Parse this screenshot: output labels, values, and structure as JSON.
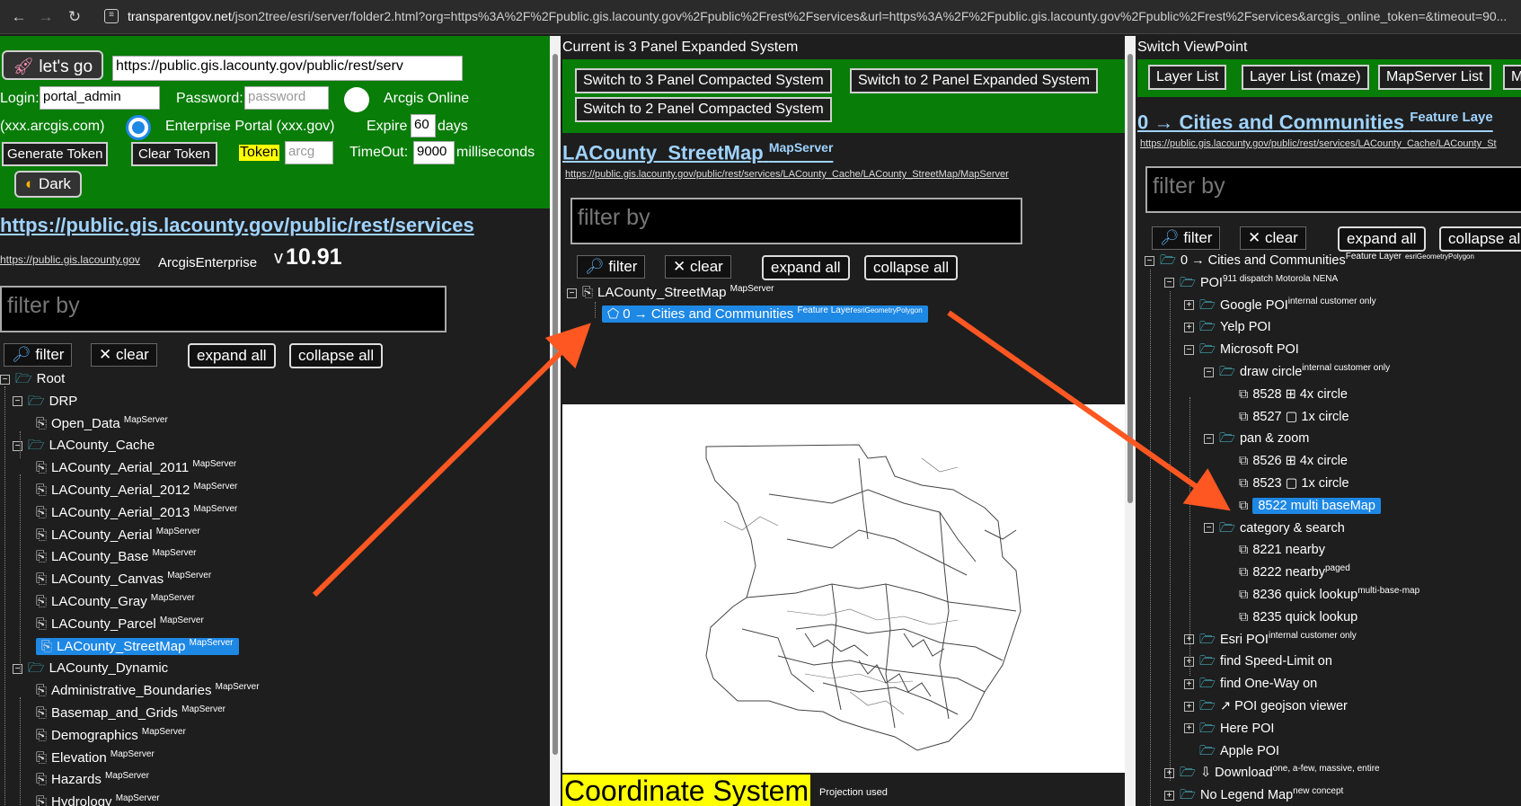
{
  "browser": {
    "url_host": "transparentgov.net",
    "url_rest": "/json2tree/esri/server/folder2.html?org=https%3A%2F%2Fpublic.gis.lacounty.gov%2Fpublic%2Frest%2Fservices&url=https%3A%2F%2Fpublic.gis.lacounty.gov%2Fpublic%2Frest%2Fservices&arcgis_online_token=&timeout=90..."
  },
  "left": {
    "lets_go": "let's go",
    "url_value": "https://public.gis.lacounty.gov/public/rest/serv",
    "login_label": "Login:",
    "login_value": "portal_admin",
    "password_label": "Password:",
    "password_placeholder": "password",
    "arcgis_online": "Arcgis Online",
    "arcgis_com": "(xxx.arcgis.com)",
    "enterprise": "Enterprise Portal (xxx.gov)",
    "expire_label": "Expire",
    "expire_value": "60",
    "days": "days",
    "generate_token": "Generate Token",
    "clear_token": "Clear Token",
    "token_label": "Token",
    "token_placeholder": "arcg",
    "timeout_label": "TimeOut:",
    "timeout_value": "9000",
    "milliseconds": "milliseconds",
    "dark": "Dark",
    "services_link": "https://public.gis.lacounty.gov/public/rest/services",
    "host_link": "https://public.gis.lacounty.gov",
    "server_type": "ArcgisEnterprise",
    "version_prefix": "v",
    "version": "10.91",
    "filter_placeholder": "filter by",
    "filter_btn": "filter",
    "clear_btn": "clear",
    "expand_all": "expand all",
    "collapse_all": "collapse all",
    "tree": [
      {
        "label": "Root",
        "sup": "",
        "kind": "root"
      },
      {
        "label": "DRP",
        "sup": "",
        "kind": "folder"
      },
      {
        "label": "Open_Data",
        "sup": "MapServer",
        "kind": "svc"
      },
      {
        "label": "LACounty_Cache",
        "sup": "",
        "kind": "folder"
      },
      {
        "label": "LACounty_Aerial_2011",
        "sup": "MapServer",
        "kind": "svc"
      },
      {
        "label": "LACounty_Aerial_2012",
        "sup": "MapServer",
        "kind": "svc"
      },
      {
        "label": "LACounty_Aerial_2013",
        "sup": "MapServer",
        "kind": "svc"
      },
      {
        "label": "LACounty_Aerial",
        "sup": "MapServer",
        "kind": "svc"
      },
      {
        "label": "LACounty_Base",
        "sup": "MapServer",
        "kind": "svc"
      },
      {
        "label": "LACounty_Canvas",
        "sup": "MapServer",
        "kind": "svc"
      },
      {
        "label": "LACounty_Gray",
        "sup": "MapServer",
        "kind": "svc"
      },
      {
        "label": "LACounty_Parcel",
        "sup": "MapServer",
        "kind": "svc"
      },
      {
        "label": "LACounty_StreetMap",
        "sup": "MapServer",
        "kind": "svc-selected"
      },
      {
        "label": "LACounty_Dynamic",
        "sup": "",
        "kind": "folder"
      },
      {
        "label": "Administrative_Boundaries",
        "sup": "MapServer",
        "kind": "svc"
      },
      {
        "label": "Basemap_and_Grids",
        "sup": "MapServer",
        "kind": "svc"
      },
      {
        "label": "Demographics",
        "sup": "MapServer",
        "kind": "svc"
      },
      {
        "label": "Elevation",
        "sup": "MapServer",
        "kind": "svc"
      },
      {
        "label": "Hazards",
        "sup": "MapServer",
        "kind": "svc"
      },
      {
        "label": "Hydrology",
        "sup": "MapServer",
        "kind": "svc"
      }
    ]
  },
  "middle": {
    "header": "Current is 3 Panel Expanded System",
    "btn1": "Switch to 3 Panel Compacted System",
    "btn2": "Switch to 2 Panel Expanded System",
    "btn3": "Switch to 2 Panel Compacted System",
    "title": "LACounty_StreetMap",
    "title_sup": "MapServer",
    "url": "https://public.gis.lacounty.gov/public/rest/services/LACounty_Cache/LACounty_StreetMap/MapServer",
    "filter_placeholder": "filter by",
    "filter_btn": "filter",
    "clear_btn": "clear",
    "expand_all": "expand all",
    "collapse_all": "collapse all",
    "tree_root": "LACounty_StreetMap",
    "tree_root_sup": "MapServer",
    "tree_child": "0 → Cities and Communities",
    "tree_child_sup": "Feature Layer",
    "tree_child_tiny": "esriGeometryPolygon",
    "coord_title": "Coordinate System",
    "coord_sub": "Projection used"
  },
  "right": {
    "header": "Switch ViewPoint",
    "btn1": "Layer List",
    "btn2": "Layer List (maze)",
    "btn3": "MapServer List",
    "btn4": "M",
    "title": "0 → Cities and Communities",
    "title_sup": "Feature Laye",
    "url": "https://public.gis.lacounty.gov/public/rest/services/LACounty_Cache/LACounty_St",
    "filter_placeholder": "filter by",
    "filter_btn": "filter",
    "clear_btn": "clear",
    "expand_all": "expand all",
    "collapse_all": "collapse all",
    "tree": [
      {
        "label": "0 → Cities and Communities",
        "sup": "Feature Layer",
        "tiny": "esriGeometryPolygon",
        "depth": 0,
        "pm": "-",
        "icon": "folder"
      },
      {
        "label": "POI",
        "sup": "911 dispatch Motorola NENA",
        "tiny": "",
        "depth": 1,
        "pm": "-",
        "icon": "folder"
      },
      {
        "label": "Google POI",
        "sup": "internal customer only",
        "tiny": "",
        "depth": 2,
        "pm": "+",
        "icon": "folder"
      },
      {
        "label": "Yelp POI",
        "sup": "",
        "tiny": "",
        "depth": 2,
        "pm": "+",
        "icon": "folder"
      },
      {
        "label": "Microsoft POI",
        "sup": "",
        "tiny": "",
        "depth": 2,
        "pm": "-",
        "icon": "folder"
      },
      {
        "label": "draw circle",
        "sup": "internal customer only",
        "tiny": "",
        "depth": 3,
        "pm": "-",
        "icon": "folder"
      },
      {
        "label": "8528 ⊞ 4x circle",
        "sup": "",
        "tiny": "",
        "depth": 4,
        "pm": "",
        "icon": "ext"
      },
      {
        "label": "8527 ▢ 1x circle",
        "sup": "",
        "tiny": "",
        "depth": 4,
        "pm": "",
        "icon": "ext"
      },
      {
        "label": "pan & zoom",
        "sup": "",
        "tiny": "",
        "depth": 3,
        "pm": "-",
        "icon": "folder"
      },
      {
        "label": "8526 ⊞ 4x circle",
        "sup": "",
        "tiny": "",
        "depth": 4,
        "pm": "",
        "icon": "ext"
      },
      {
        "label": "8523 ▢ 1x circle",
        "sup": "",
        "tiny": "",
        "depth": 4,
        "pm": "",
        "icon": "ext"
      },
      {
        "label": "8522 multi baseMap",
        "sup": "",
        "tiny": "",
        "depth": 4,
        "pm": "",
        "icon": "ext-selected"
      },
      {
        "label": "category & search",
        "sup": "",
        "tiny": "",
        "depth": 3,
        "pm": "-",
        "icon": "folder"
      },
      {
        "label": "8221 nearby",
        "sup": "",
        "tiny": "",
        "depth": 4,
        "pm": "",
        "icon": "ext"
      },
      {
        "label": "8222 nearby",
        "sup": "paged",
        "tiny": "",
        "depth": 4,
        "pm": "",
        "icon": "ext"
      },
      {
        "label": "8236 quick lookup",
        "sup": "multi-base-map",
        "tiny": "",
        "depth": 4,
        "pm": "",
        "icon": "ext"
      },
      {
        "label": "8235 quick lookup",
        "sup": "",
        "tiny": "",
        "depth": 4,
        "pm": "",
        "icon": "ext"
      },
      {
        "label": "Esri POI",
        "sup": "internal customer only",
        "tiny": "",
        "depth": 2,
        "pm": "+",
        "icon": "folder"
      },
      {
        "label": "find Speed-Limit on",
        "sup": "",
        "tiny": "",
        "depth": 2,
        "pm": "+",
        "icon": "folder"
      },
      {
        "label": "find One-Way on",
        "sup": "",
        "tiny": "",
        "depth": 2,
        "pm": "+",
        "icon": "folder"
      },
      {
        "label": "↗ POI geojson viewer",
        "sup": "",
        "tiny": "",
        "depth": 2,
        "pm": "+",
        "icon": "folder"
      },
      {
        "label": "Here POI",
        "sup": "",
        "tiny": "",
        "depth": 2,
        "pm": "+",
        "icon": "folder"
      },
      {
        "label": "Apple POI",
        "sup": "",
        "tiny": "",
        "depth": 2,
        "pm": "",
        "icon": "folder"
      },
      {
        "label": "⇩ Download",
        "sup": "one, a-few, massive, entire",
        "tiny": "",
        "depth": 1,
        "pm": "+",
        "icon": "folder"
      },
      {
        "label": "No Legend Map",
        "sup": "new concept",
        "tiny": "",
        "depth": 1,
        "pm": "+",
        "icon": "folder"
      }
    ]
  },
  "colors": {
    "green_header": "#087d08",
    "selected": "#1e88e5",
    "arrow": "#ff5722",
    "link": "#9fd3ff",
    "highlight": "#ffff00"
  }
}
